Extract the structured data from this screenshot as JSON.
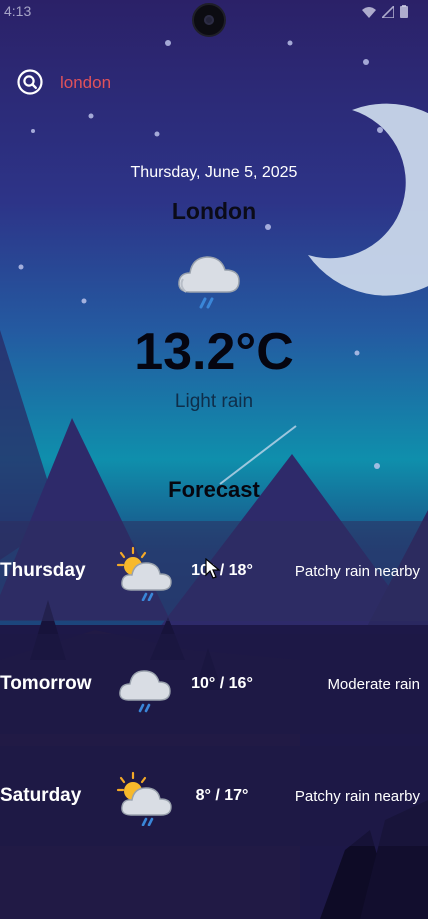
{
  "status_bar": {
    "time": "4:13"
  },
  "search": {
    "query": "london",
    "icon": "search-icon"
  },
  "weather": {
    "date": "Thursday, June 5, 2025",
    "city": "London",
    "temperature": "13.2°C",
    "condition": "Light rain",
    "icon": "cloud-rain-icon"
  },
  "forecast": {
    "title": "Forecast",
    "days": [
      {
        "day": "Thursday",
        "range": "10° / 18°",
        "description": "Patchy rain nearby",
        "icon": "sun-cloud-rain-icon"
      },
      {
        "day": "Tomorrow",
        "range": "10° / 16°",
        "description": "Moderate rain",
        "icon": "cloud-rain-icon"
      },
      {
        "day": "Saturday",
        "range": "8° / 17°",
        "description": "Patchy rain nearby",
        "icon": "sun-cloud-rain-icon"
      }
    ]
  },
  "colors": {
    "search_text": "#e0525a",
    "sky_top": "#2a2366",
    "horizon": "#0e8da8",
    "moon": "#c9d7ea"
  }
}
